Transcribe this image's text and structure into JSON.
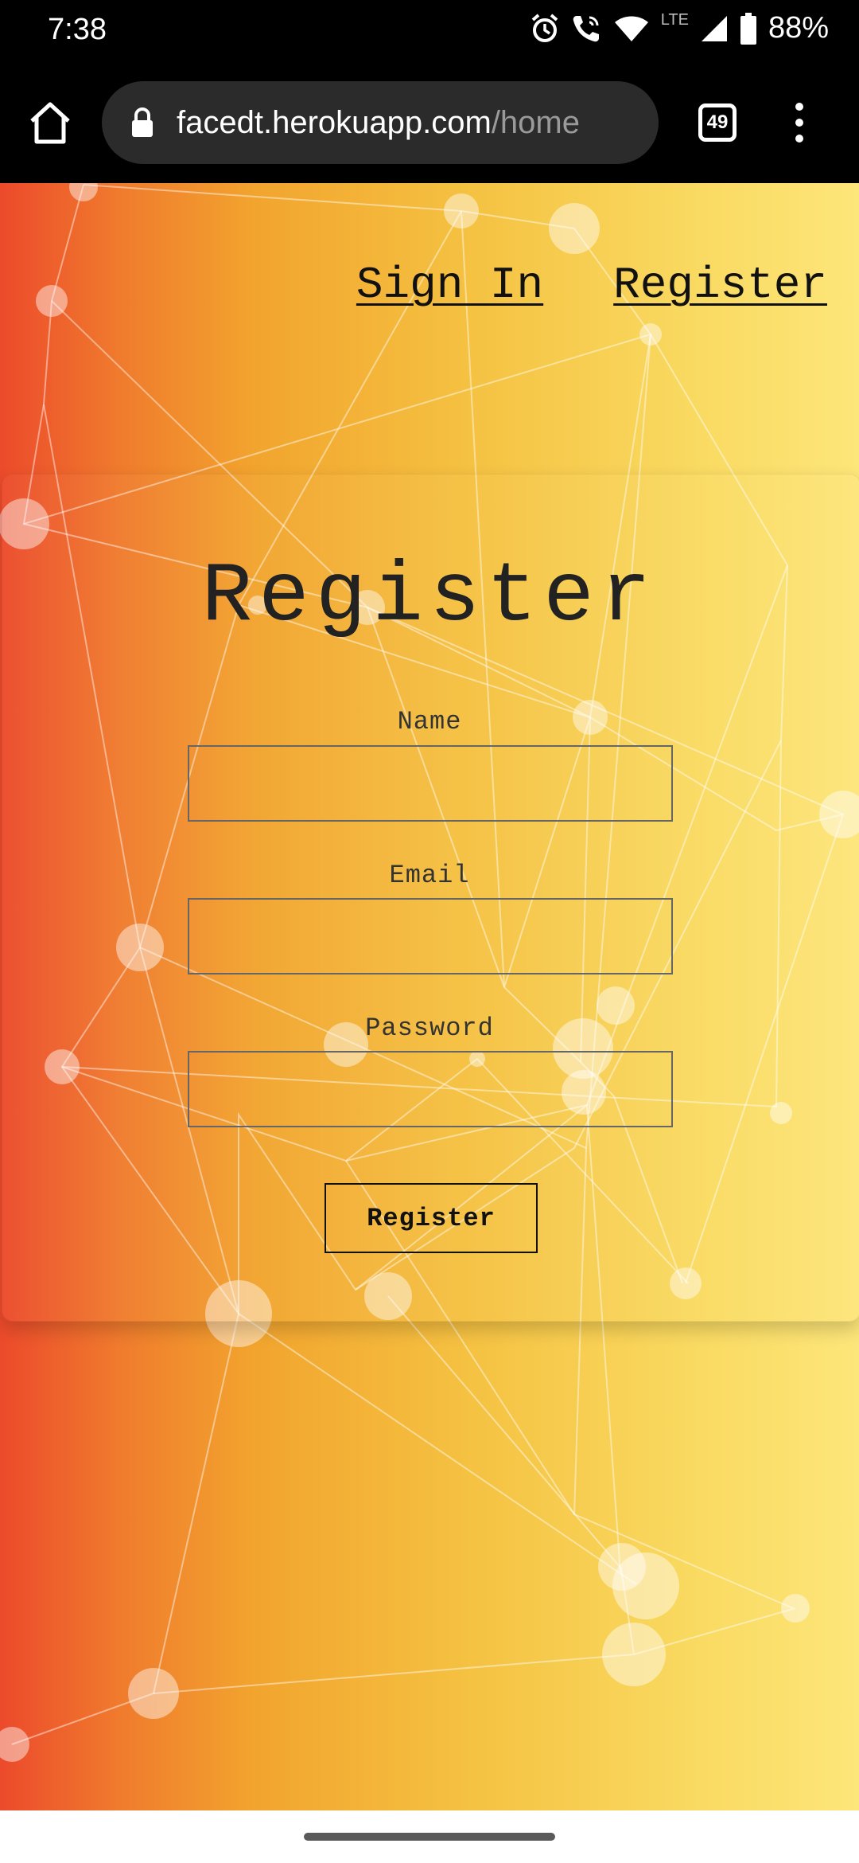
{
  "status_bar": {
    "time": "7:38",
    "network_label": "LTE",
    "battery_percent": "88%",
    "icons": [
      "alarm-icon",
      "wifi-call-icon",
      "wifi-icon",
      "signal-icon",
      "battery-icon"
    ]
  },
  "browser": {
    "url_domain": "facedt.herokuapp.com",
    "url_path": "/home",
    "tab_count": "49",
    "icons": [
      "home-icon",
      "lock-icon",
      "tabs-icon",
      "more-vert-icon"
    ]
  },
  "page": {
    "nav": {
      "sign_in": "Sign In",
      "register": "Register"
    },
    "form": {
      "title": "Register",
      "name_label": "Name",
      "name_value": "",
      "email_label": "Email",
      "email_value": "",
      "password_label": "Password",
      "password_value": "",
      "submit_label": "Register"
    }
  },
  "colors": {
    "gradient_start": "#ec4a2b",
    "gradient_mid": "#f2a52e",
    "gradient_end": "#fde67a",
    "text": "#222222"
  }
}
